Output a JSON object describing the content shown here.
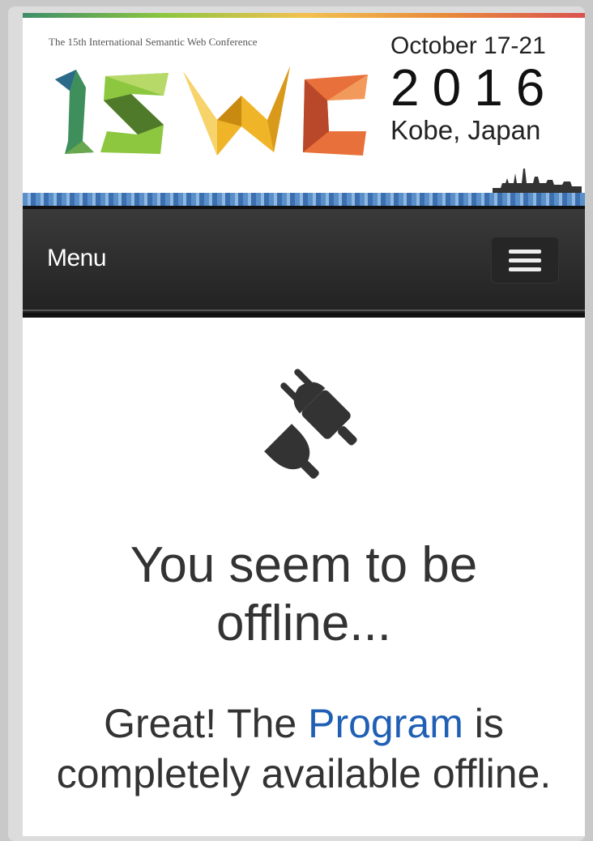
{
  "header": {
    "tagline": "The 15th International Semantic Web Conference",
    "logo_text": "ISWC",
    "date_range": "October 17-21",
    "year": "2016",
    "location": "Kobe, Japan"
  },
  "navbar": {
    "menu_label": "Menu",
    "toggle_icon": "hamburger-icon"
  },
  "main": {
    "icon": "unplugged-icon",
    "title": "You seem to be offline...",
    "message_prefix": "Great! The ",
    "link_text": "Program",
    "message_suffix": " is completely available offline."
  },
  "colors": {
    "navbar": "#2b2b2b",
    "text": "#333333",
    "link": "#1f5fb4"
  }
}
